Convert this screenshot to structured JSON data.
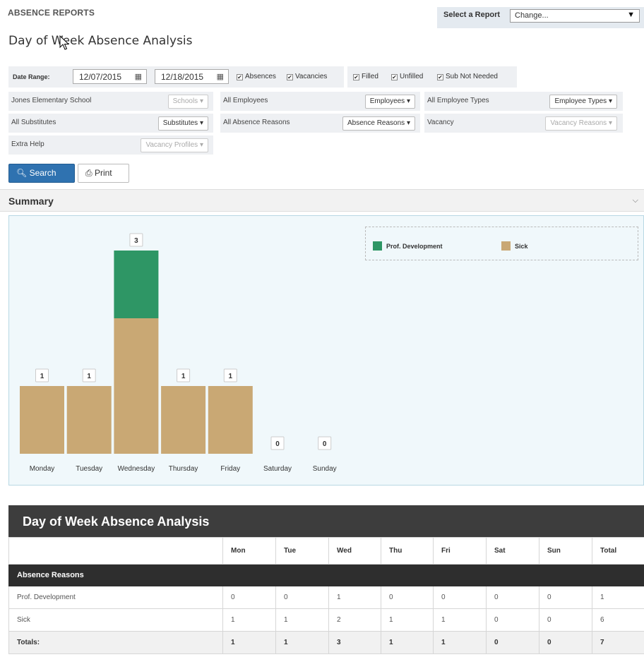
{
  "header": {
    "section": "ABSENCE REPORTS",
    "select_label": "Select a Report",
    "select_value": "Change...",
    "page_title": "Day of Week Absence Analysis"
  },
  "filters": {
    "date_range_label": "Date Range:",
    "start_date": "12/07/2015",
    "end_date": "12/18/2015",
    "checks": [
      {
        "label": "Absences",
        "checked": true
      },
      {
        "label": "Vacancies",
        "checked": true
      },
      {
        "label": "Filled",
        "checked": true
      },
      {
        "label": "Unfilled",
        "checked": true
      },
      {
        "label": "Sub Not Needed",
        "checked": true
      }
    ],
    "cells": [
      {
        "label": "Jones Elementary School",
        "button": "Schools",
        "disabled": true
      },
      {
        "label": "All Employees",
        "button": "Employees",
        "disabled": false
      },
      {
        "label": "All Employee Types",
        "button": "Employee Types",
        "disabled": false
      },
      {
        "label": "All Substitutes",
        "button": "Substitutes",
        "disabled": false
      },
      {
        "label": "All Absence Reasons",
        "button": "Absence Reasons",
        "disabled": false
      },
      {
        "label": "Vacancy",
        "button": "Vacancy Reasons",
        "disabled": true
      },
      {
        "label": "Extra Help",
        "button": "Vacancy Profiles",
        "disabled": true
      }
    ],
    "search_label": "Search",
    "print_label": "Print"
  },
  "summary": {
    "title": "Summary"
  },
  "colors": {
    "prof_dev": "#2e9665",
    "sick": "#c9a874",
    "primary": "#2f72b0"
  },
  "chart_data": {
    "type": "bar",
    "stacked": true,
    "categories": [
      "Monday",
      "Tuesday",
      "Wednesday",
      "Thursday",
      "Friday",
      "Saturday",
      "Sunday"
    ],
    "series": [
      {
        "name": "Sick",
        "values": [
          1,
          1,
          2,
          1,
          1,
          0,
          0
        ],
        "color": "#c9a874"
      },
      {
        "name": "Prof. Development",
        "values": [
          0,
          0,
          1,
          0,
          0,
          0,
          0
        ],
        "color": "#2e9665"
      }
    ],
    "totals": [
      1,
      1,
      3,
      1,
      1,
      0,
      0
    ],
    "ylim": [
      0,
      3
    ],
    "legend_position": "top-right",
    "legend_order": [
      "Prof. Development",
      "Sick"
    ]
  },
  "table": {
    "title": "Day of Week Absence Analysis",
    "columns": [
      "",
      "Mon",
      "Tue",
      "Wed",
      "Thu",
      "Fri",
      "Sat",
      "Sun",
      "Total"
    ],
    "group_label": "Absence Reasons",
    "rows": [
      {
        "label": "Prof. Development",
        "cells": [
          "0",
          "0",
          "1",
          "0",
          "0",
          "0",
          "0",
          "1"
        ]
      },
      {
        "label": "Sick",
        "cells": [
          "1",
          "1",
          "2",
          "1",
          "1",
          "0",
          "0",
          "6"
        ]
      }
    ],
    "totals_label": "Totals:",
    "totals": [
      "1",
      "1",
      "3",
      "1",
      "1",
      "0",
      "0",
      "7"
    ]
  }
}
